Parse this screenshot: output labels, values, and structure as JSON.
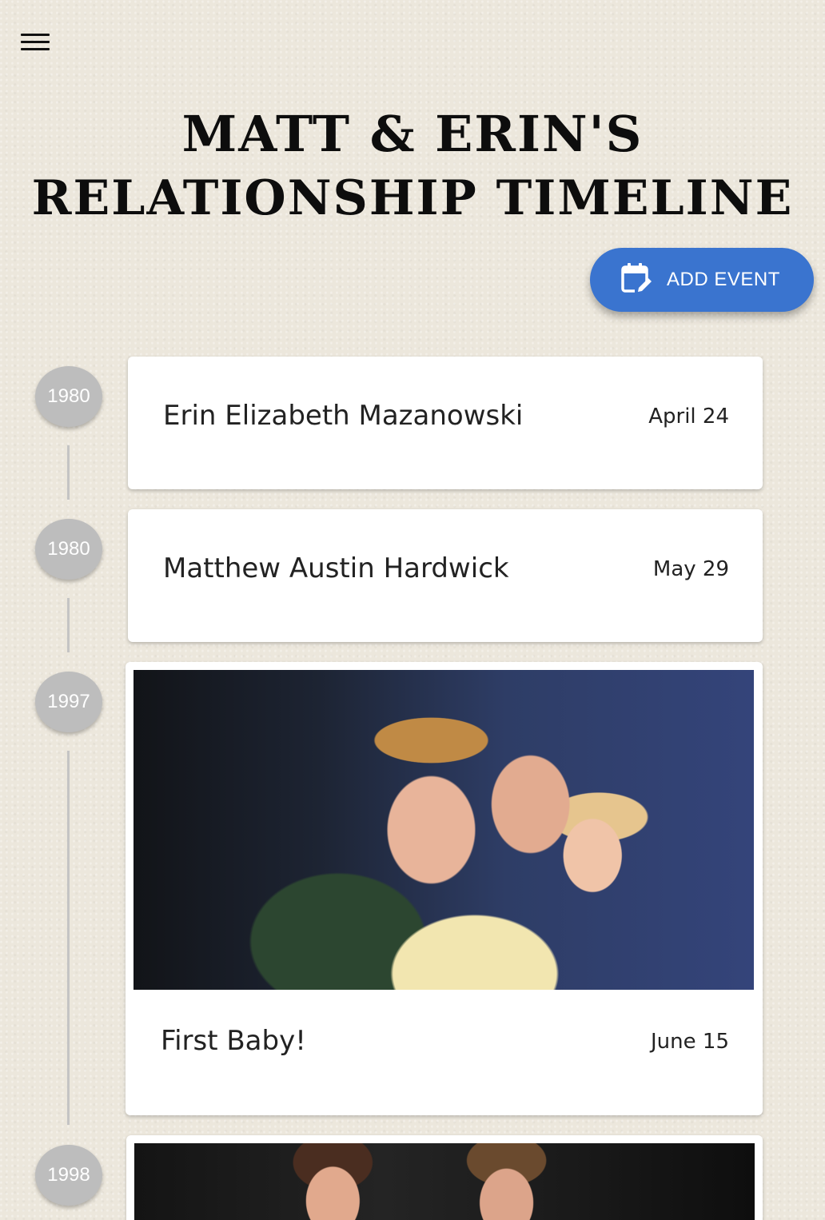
{
  "header": {
    "title_line1": "Matt & Erin's",
    "title_line2": "Relationship Timeline"
  },
  "toolbar": {
    "add_event_label": "ADD EVENT",
    "accent_color": "#3a74cf"
  },
  "timeline": {
    "events": [
      {
        "year": "1980",
        "title": "Erin Elizabeth Mazanowski",
        "date": "April 24",
        "has_photo": false
      },
      {
        "year": "1980",
        "title": "Matthew Austin Hardwick",
        "date": "May 29",
        "has_photo": false
      },
      {
        "year": "1997",
        "title": "First Baby!",
        "date": "June 15",
        "has_photo": true
      },
      {
        "year": "1998",
        "title": "",
        "date": "",
        "has_photo": true
      }
    ]
  }
}
